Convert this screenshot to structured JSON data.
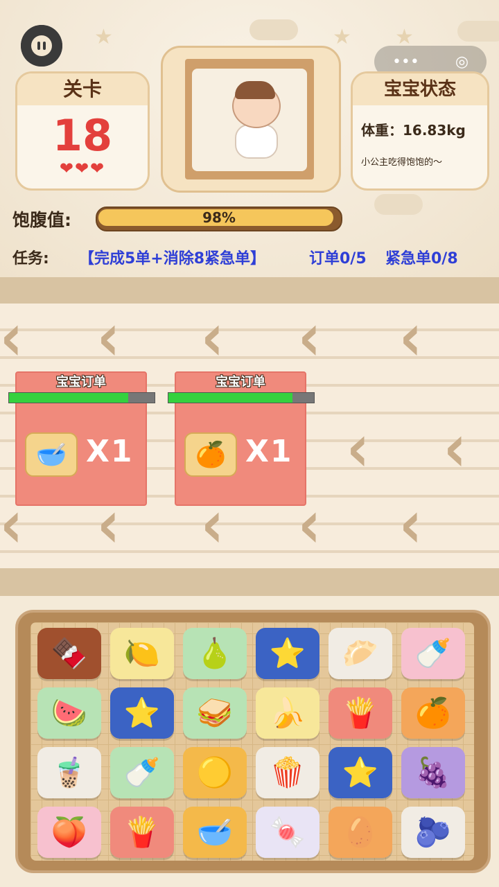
{
  "hud": {
    "level_label": "关卡",
    "level_value": "18",
    "hearts": "❤❤❤",
    "status_title": "宝宝状态",
    "weight": "体重：16.83kg",
    "status_note": "小公主吃得饱饱的～",
    "satiety_label": "饱腹值:",
    "satiety_text": "98%",
    "satiety_percent": 98,
    "task_label": "任务:",
    "task_desc": "【完成5单+消除8紧急单】",
    "task_orders": "订单0/5",
    "task_urgent": "紧急单0/8",
    "menu_dots": "•••",
    "menu_target": "◎"
  },
  "orders": [
    {
      "title": "宝宝订单",
      "icon": "🥣",
      "qty": "X1",
      "timer_fraction": 0.82
    },
    {
      "title": "宝宝订单",
      "icon": "🍊",
      "qty": "X1",
      "timer_fraction": 0.85
    }
  ],
  "tiles": [
    {
      "icon": "🍫",
      "color": "#a0502e"
    },
    {
      "icon": "🍋",
      "color": "#f7e79a"
    },
    {
      "icon": "🍐",
      "color": "#b7e3b5"
    },
    {
      "icon": "⭐",
      "color": "#3b63c4"
    },
    {
      "icon": "🥟",
      "color": "#f1ece4"
    },
    {
      "icon": "🍼",
      "color": "#f7c1cf"
    },
    {
      "icon": "🍉",
      "color": "#b7e3b5"
    },
    {
      "icon": "⭐",
      "color": "#3b63c4"
    },
    {
      "icon": "🥪",
      "color": "#b7e3b5"
    },
    {
      "icon": "🍌",
      "color": "#f7e79a"
    },
    {
      "icon": "🍟",
      "color": "#f08a7c"
    },
    {
      "icon": "🍊",
      "color": "#f4a65a"
    },
    {
      "icon": "🧋",
      "color": "#f1ece4"
    },
    {
      "icon": "🍼",
      "color": "#b7e3b5"
    },
    {
      "icon": "🟡",
      "color": "#f4b94a"
    },
    {
      "icon": "🍿",
      "color": "#f1ece4"
    },
    {
      "icon": "⭐",
      "color": "#3b63c4"
    },
    {
      "icon": "🍇",
      "color": "#b59ae0"
    },
    {
      "icon": "🍑",
      "color": "#f7c1cf"
    },
    {
      "icon": "🍟",
      "color": "#f08a7c"
    },
    {
      "icon": "🥣",
      "color": "#f4b94a"
    },
    {
      "icon": "🍬",
      "color": "#e9e4f5"
    },
    {
      "icon": "🥚",
      "color": "#f4a65a"
    },
    {
      "icon": "🫐",
      "color": "#f1ece4"
    }
  ]
}
